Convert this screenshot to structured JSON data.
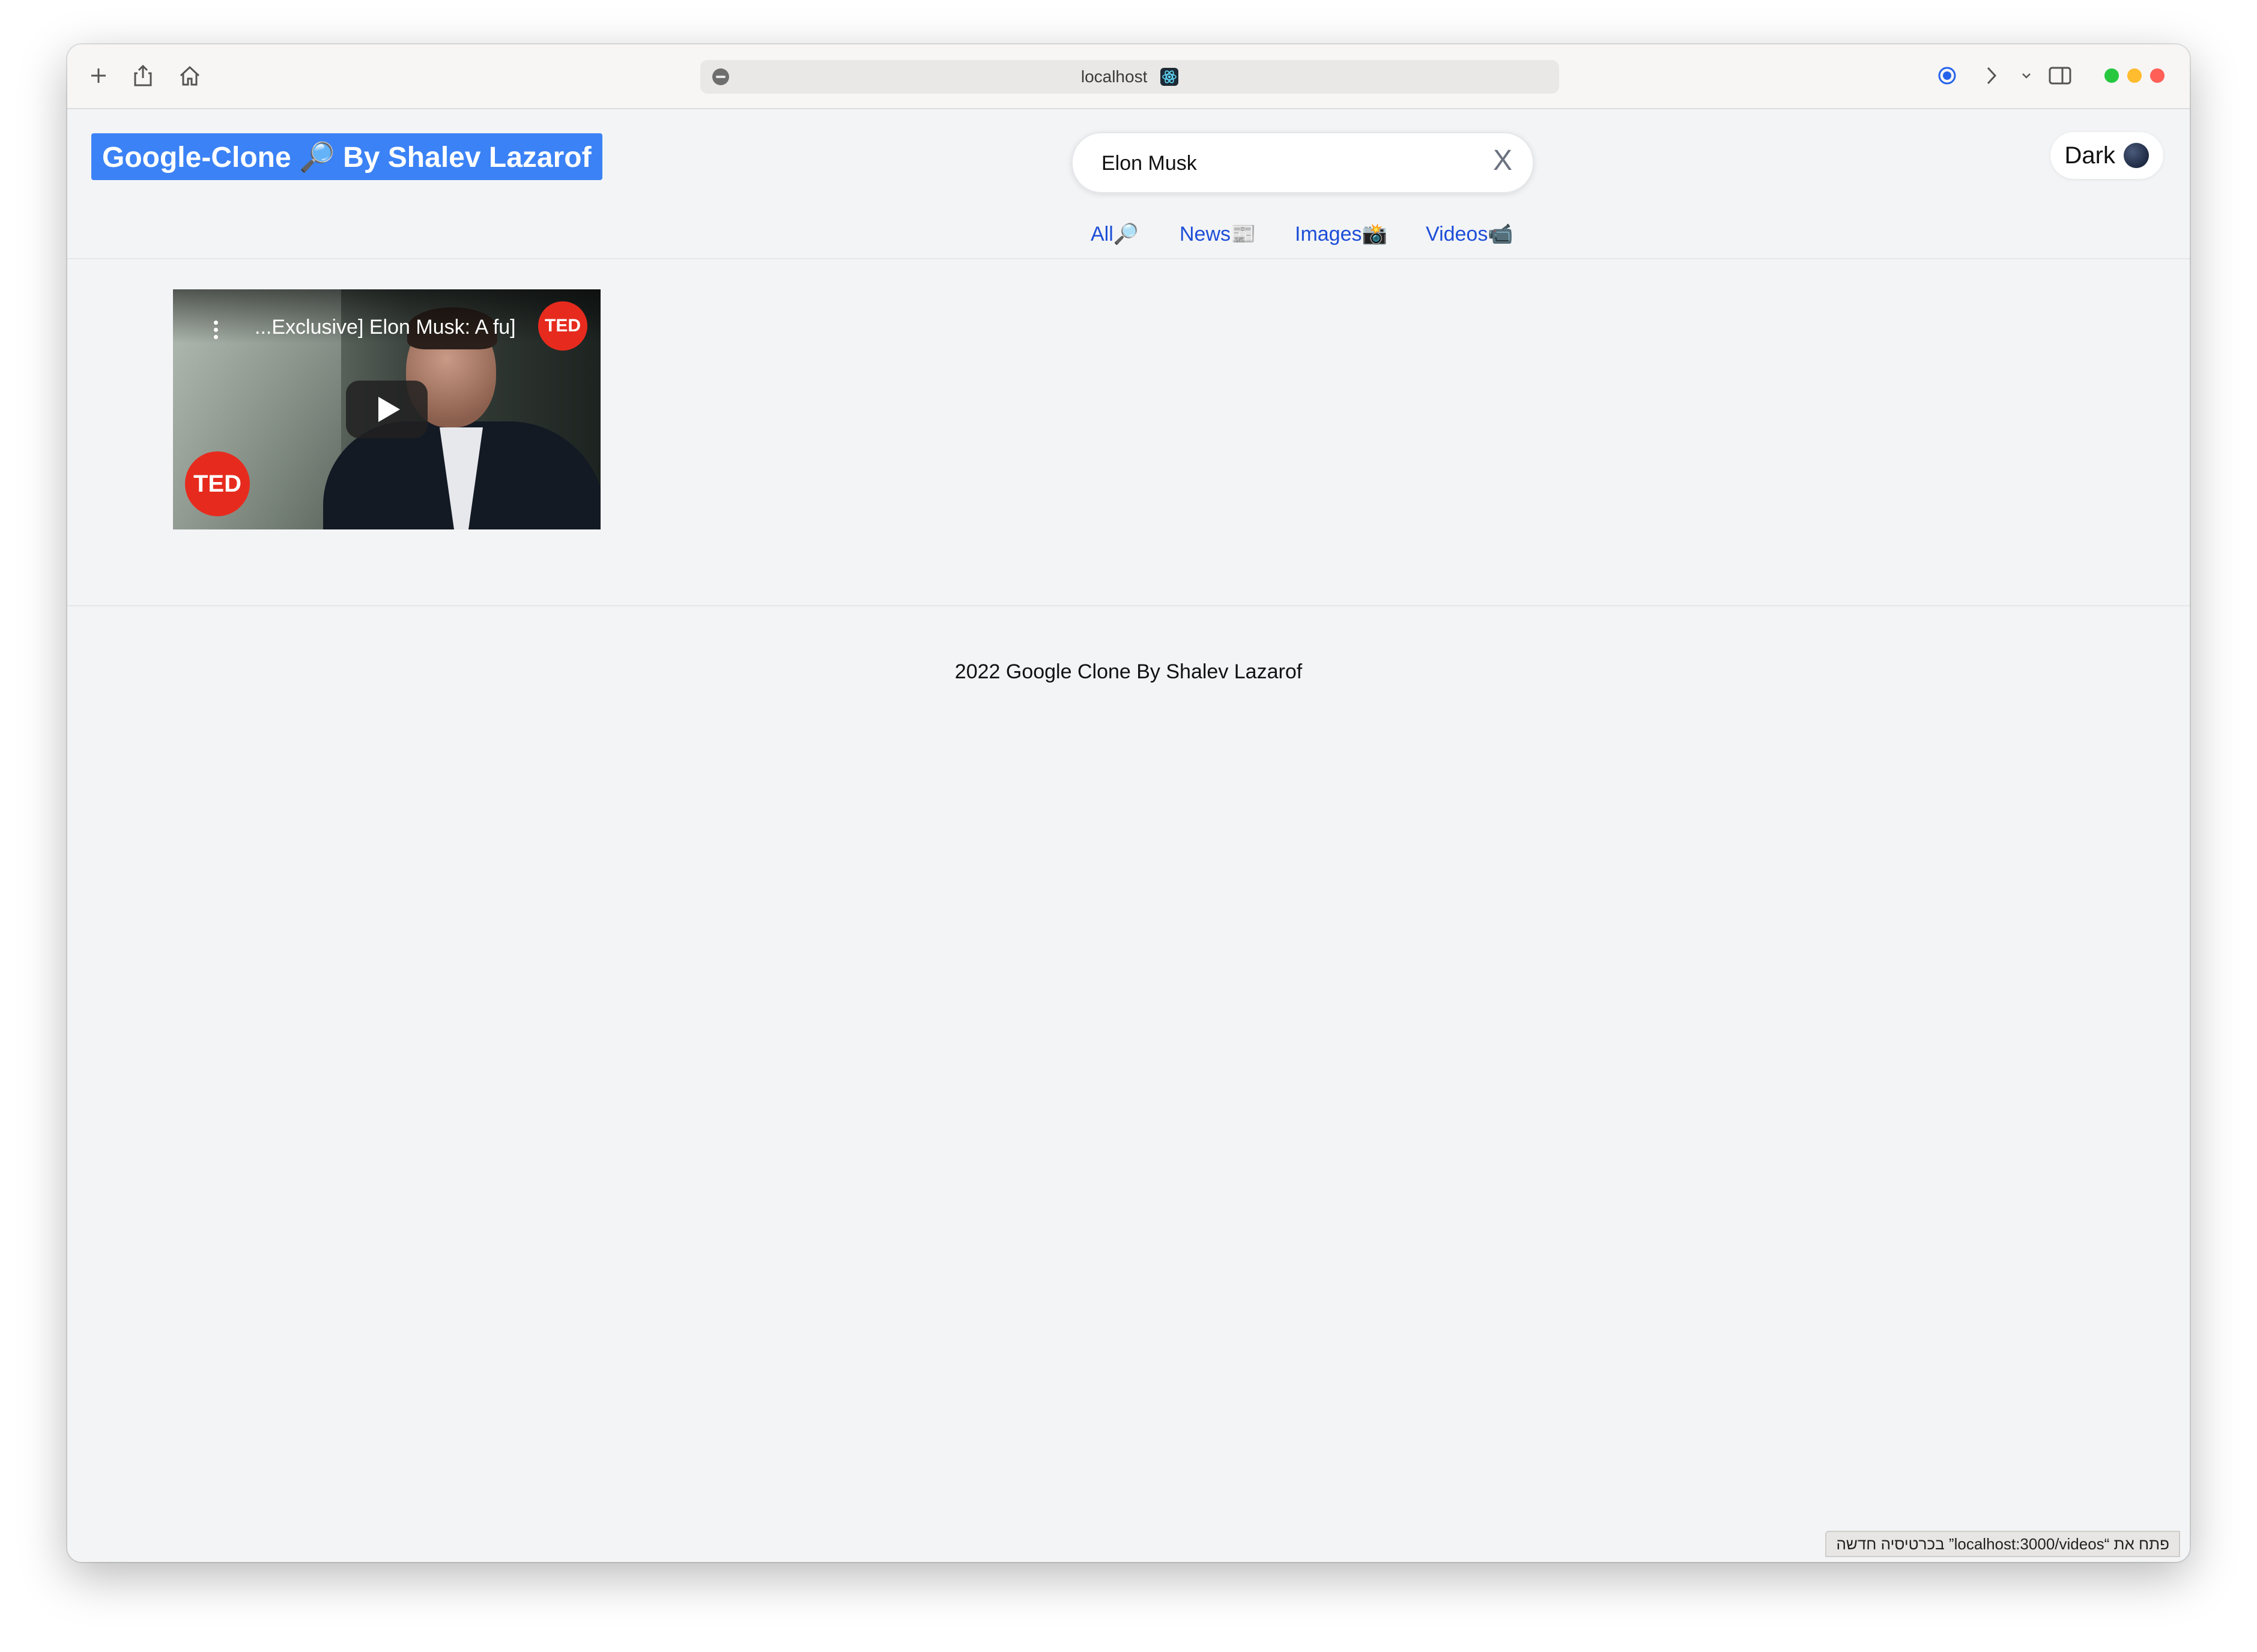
{
  "browser": {
    "url": "localhost",
    "status_bar": "פתח את “localhost:3000/videos” בכרטיסיה חדשה"
  },
  "header": {
    "logo_text": "Google-Clone 🔎 By Shalev Lazarof",
    "search_value": "Elon Musk",
    "clear_label": "X",
    "theme_button_label": "Dark"
  },
  "tabs": [
    {
      "label": "All🔎"
    },
    {
      "label": "News📰"
    },
    {
      "label": "Images📸"
    },
    {
      "label": "Videos📹"
    }
  ],
  "video": {
    "title": "...Exclusive] Elon Musk: A fu]",
    "channel_badge": "TED",
    "watermark": "TED"
  },
  "footer": {
    "text": "2022 Google Clone By Shalev Lazarof"
  },
  "colors": {
    "logo_bg": "#3b82f6",
    "tab_link": "#1d4ed8",
    "ted_red": "#e62b1e",
    "page_bg": "#f3f4f6"
  }
}
